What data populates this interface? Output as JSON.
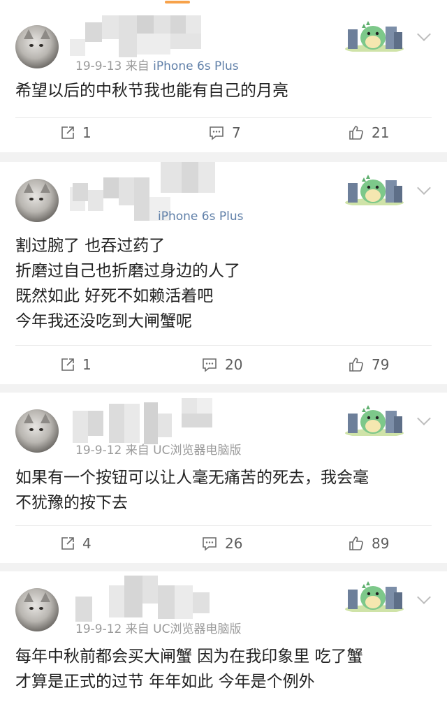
{
  "posts": [
    {
      "meta_date": "19-9-13",
      "meta_from": "来自",
      "meta_source": "iPhone 6s Plus",
      "lines": [
        "希望以后的中秋节我也能有自己的月亮"
      ],
      "reposts": "1",
      "comments": "7",
      "likes": "21"
    },
    {
      "meta_date": "",
      "meta_from": "",
      "meta_source": "iPhone 6s Plus",
      "lines": [
        "割过腕了 也吞过药了",
        "折磨过自己也折磨过身边的人了",
        "既然如此 好死不如赖活着吧",
        "今年我还没吃到大闸蟹呢"
      ],
      "reposts": "1",
      "comments": "20",
      "likes": "79"
    },
    {
      "meta_date": "19-9-12",
      "meta_from": "来自",
      "meta_source": "UC浏览器电脑版",
      "lines": [
        "如果有一个按钮可以让人毫无痛苦的死去，我会毫",
        "不犹豫的按下去"
      ],
      "reposts": "4",
      "comments": "26",
      "likes": "89"
    },
    {
      "meta_date": "19-9-12",
      "meta_from": "来自",
      "meta_source": "UC浏览器电脑版",
      "lines": [
        "每年中秋前都会买大闸蟹 因为在我印象里 吃了蟹",
        "才算是正式的过节 年年如此 今年是个例外"
      ]
    }
  ],
  "icons": {
    "repost": "repost-icon",
    "comment": "comment-icon",
    "like": "thumbs-up-icon",
    "more": "chevron-down-icon",
    "badge": "dinosaur-sticker-icon"
  },
  "colors": {
    "accent": "#f7a24a",
    "source_link": "#5f7fa8",
    "text": "#222222",
    "muted": "#9a9a9a"
  }
}
